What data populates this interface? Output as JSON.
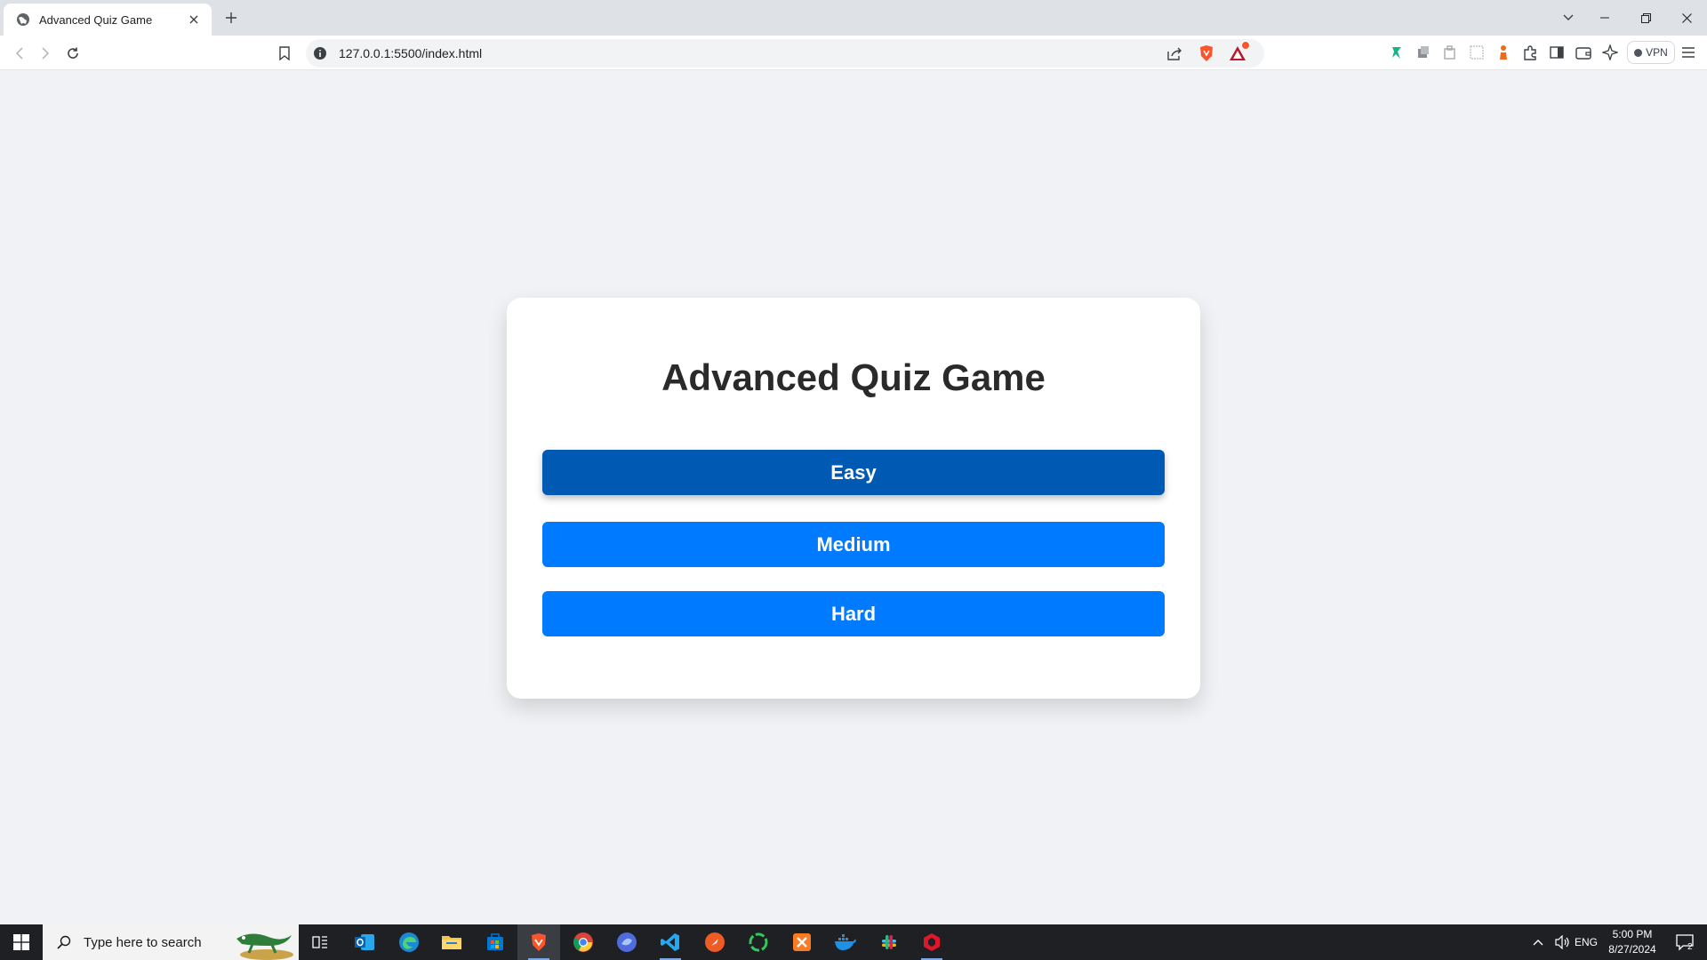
{
  "browser": {
    "tab_title": "Advanced Quiz Game",
    "url": "127.0.0.1:5500/index.html",
    "vpn_label": "VPN",
    "accent": "#fb542b"
  },
  "page": {
    "title": "Advanced Quiz Game",
    "buttons": {
      "easy": "Easy",
      "medium": "Medium",
      "hard": "Hard"
    },
    "colors": {
      "selected_button": "#0059b3",
      "button": "#007bff",
      "background": "#f0f2f5"
    }
  },
  "taskbar": {
    "search_placeholder": "Type here to search",
    "language": "ENG",
    "time": "5:00 PM",
    "date": "8/27/2024",
    "notification_count": "2",
    "apps": [
      "task-view",
      "outlook",
      "edge",
      "file-explorer",
      "store",
      "brave",
      "chrome",
      "app-blue",
      "vscode",
      "postman",
      "app-green",
      "xampp",
      "docker",
      "slack",
      "app-red"
    ]
  }
}
